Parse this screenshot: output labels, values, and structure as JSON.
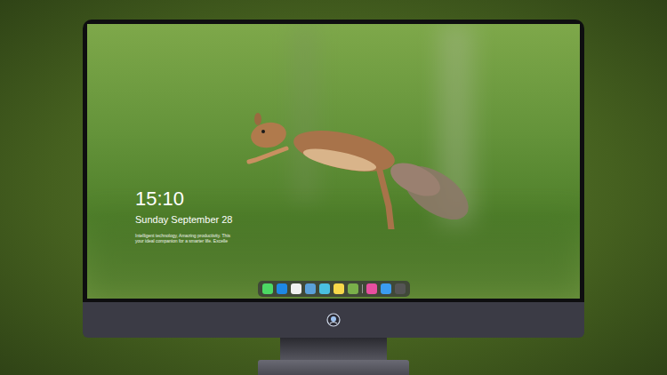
{
  "lock_screen": {
    "time": "15:10",
    "date": "Sunday September 28",
    "caption": [
      "Intelligent technology, Amazing productivity. This",
      "your ideal companion for a smarter life. Excelle"
    ]
  },
  "dock": {
    "items": [
      {
        "kind": "app",
        "color": "#4cd964"
      },
      {
        "kind": "app",
        "color": "#1e88e5"
      },
      {
        "kind": "app",
        "color": "#f0f0f0"
      },
      {
        "kind": "app",
        "color": "#5aa0d8"
      },
      {
        "kind": "app",
        "color": "#4ac0e0"
      },
      {
        "kind": "app",
        "color": "#f7d84a"
      },
      {
        "kind": "app",
        "color": "#7ab04a"
      },
      {
        "kind": "separator",
        "color": "#9a9a9a"
      },
      {
        "kind": "app",
        "color": "#e84fa0"
      },
      {
        "kind": "app",
        "color": "#3b9cf0"
      },
      {
        "kind": "app",
        "color": "#555555"
      }
    ]
  }
}
